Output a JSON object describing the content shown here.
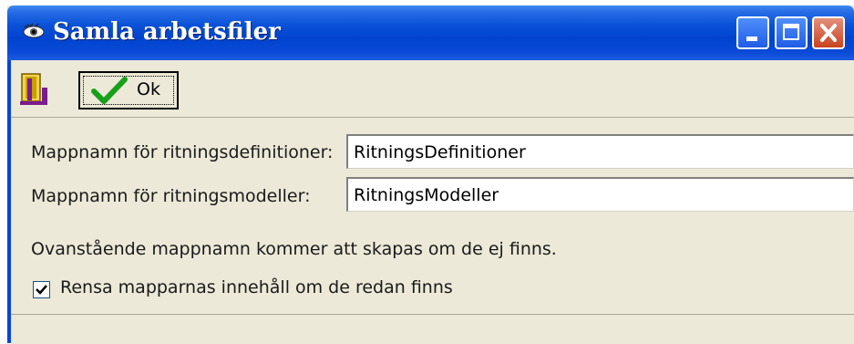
{
  "window": {
    "title": "Samla arbetsfiler",
    "controls": {
      "minimize": "minimize-icon",
      "maximize": "maximize-icon",
      "close": "close-icon"
    },
    "colors": {
      "titlebar": "#0a52d8",
      "close": "#c9431f",
      "face": "#ece9d8"
    }
  },
  "toolbar": {
    "exit_icon": "exit-door-icon",
    "ok_label": "Ok",
    "ok_icon": "checkmark-icon"
  },
  "form": {
    "def_label": "Mappnamn för ritningsdefinitioner:",
    "def_value": "RitningsDefinitioner",
    "model_label": "Mappnamn för ritningsmodeller:",
    "model_value": "RitningsModeller",
    "info_text": "Ovanstående mappnamn kommer att skapas om  de ej finns.",
    "clear_checked": true,
    "clear_label": "Rensa mapparnas innehåll om de redan finns"
  }
}
